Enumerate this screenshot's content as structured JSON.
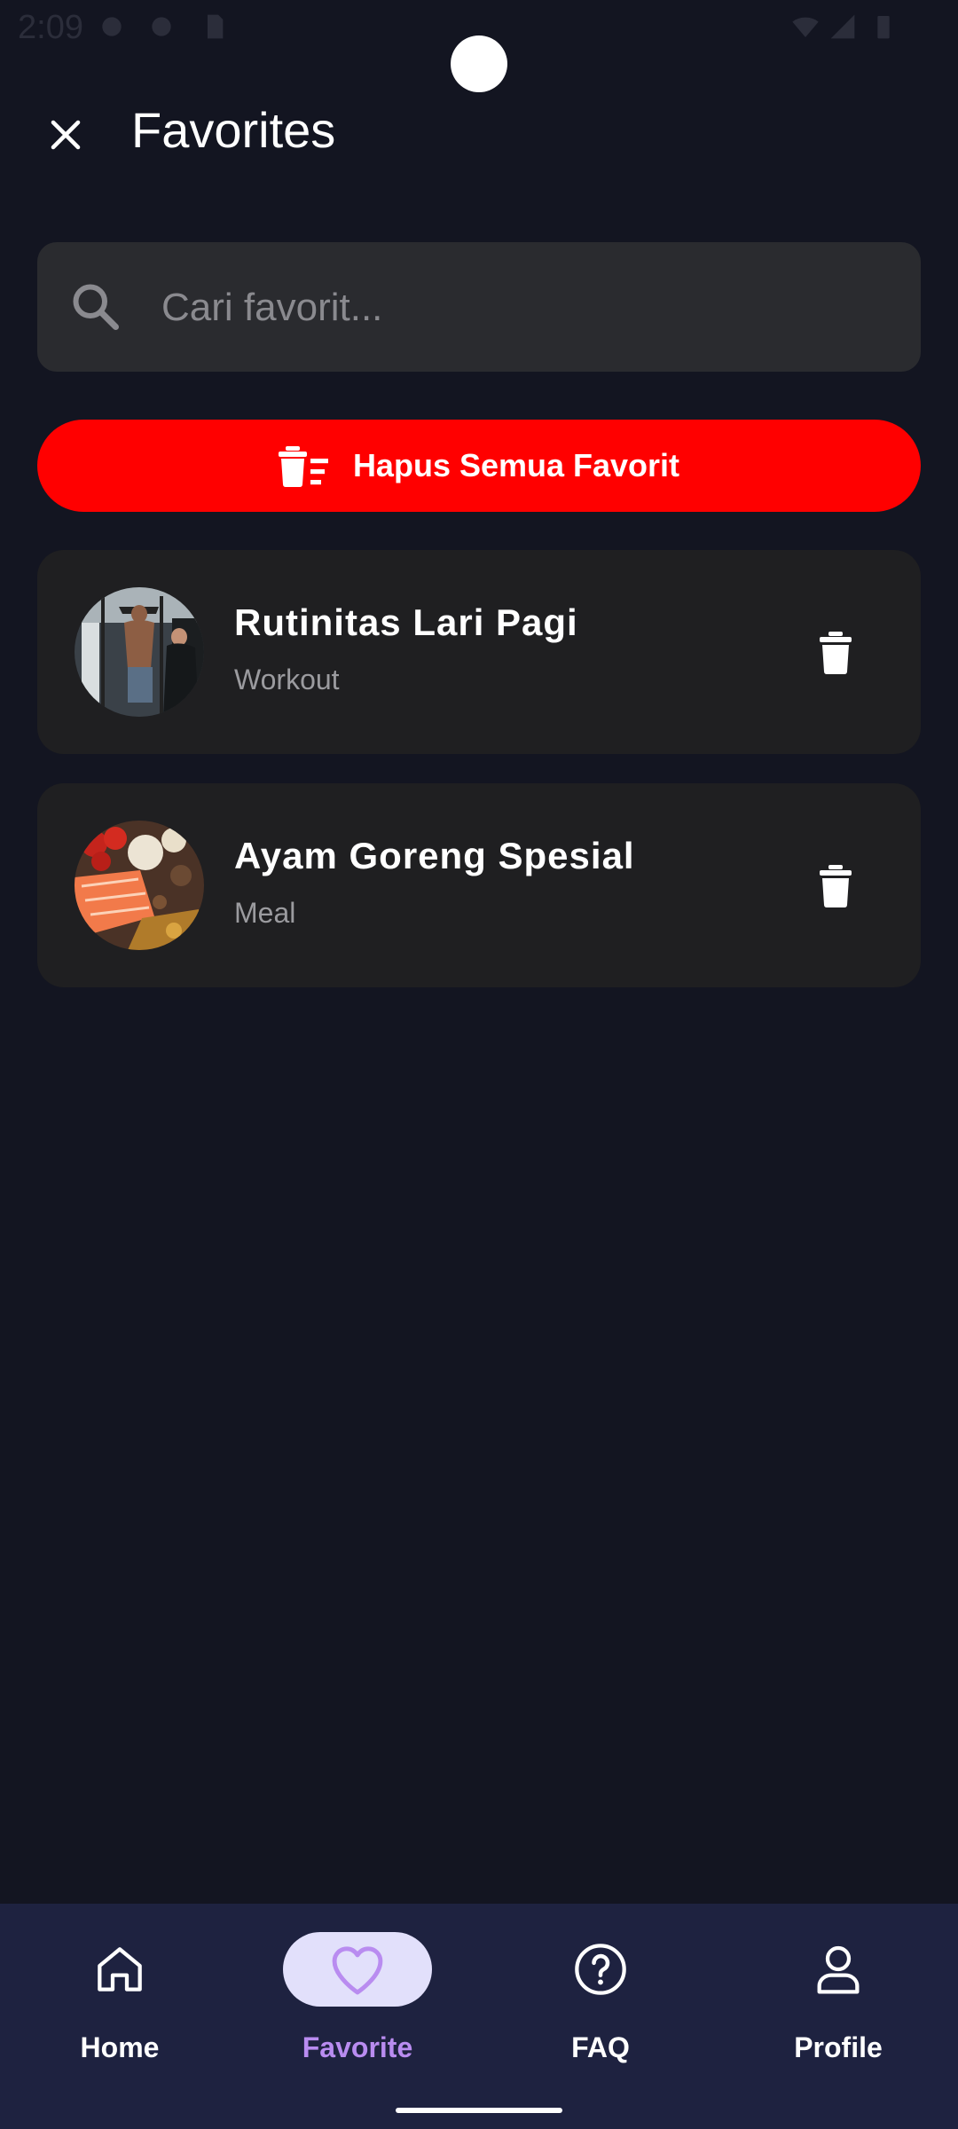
{
  "status": {
    "time": "2:09"
  },
  "header": {
    "title": "Favorites"
  },
  "search": {
    "placeholder": "Cari favorit..."
  },
  "clear_all": {
    "label": "Hapus Semua Favorit"
  },
  "favorites": [
    {
      "title": "Rutinitas Lari Pagi",
      "type": "Workout"
    },
    {
      "title": "Ayam Goreng Spesial",
      "type": "Meal"
    }
  ],
  "nav": [
    {
      "label": "Home",
      "icon": "home-icon",
      "active": false
    },
    {
      "label": "Favorite",
      "icon": "heart-icon",
      "active": true
    },
    {
      "label": "FAQ",
      "icon": "help-circle-icon",
      "active": false
    },
    {
      "label": "Profile",
      "icon": "person-icon",
      "active": false
    }
  ],
  "colors": {
    "background": "#131521",
    "danger": "#ff0000",
    "card": "#1f1f21",
    "nav_bg": "#1e2240",
    "nav_active": "#b98cf0"
  }
}
